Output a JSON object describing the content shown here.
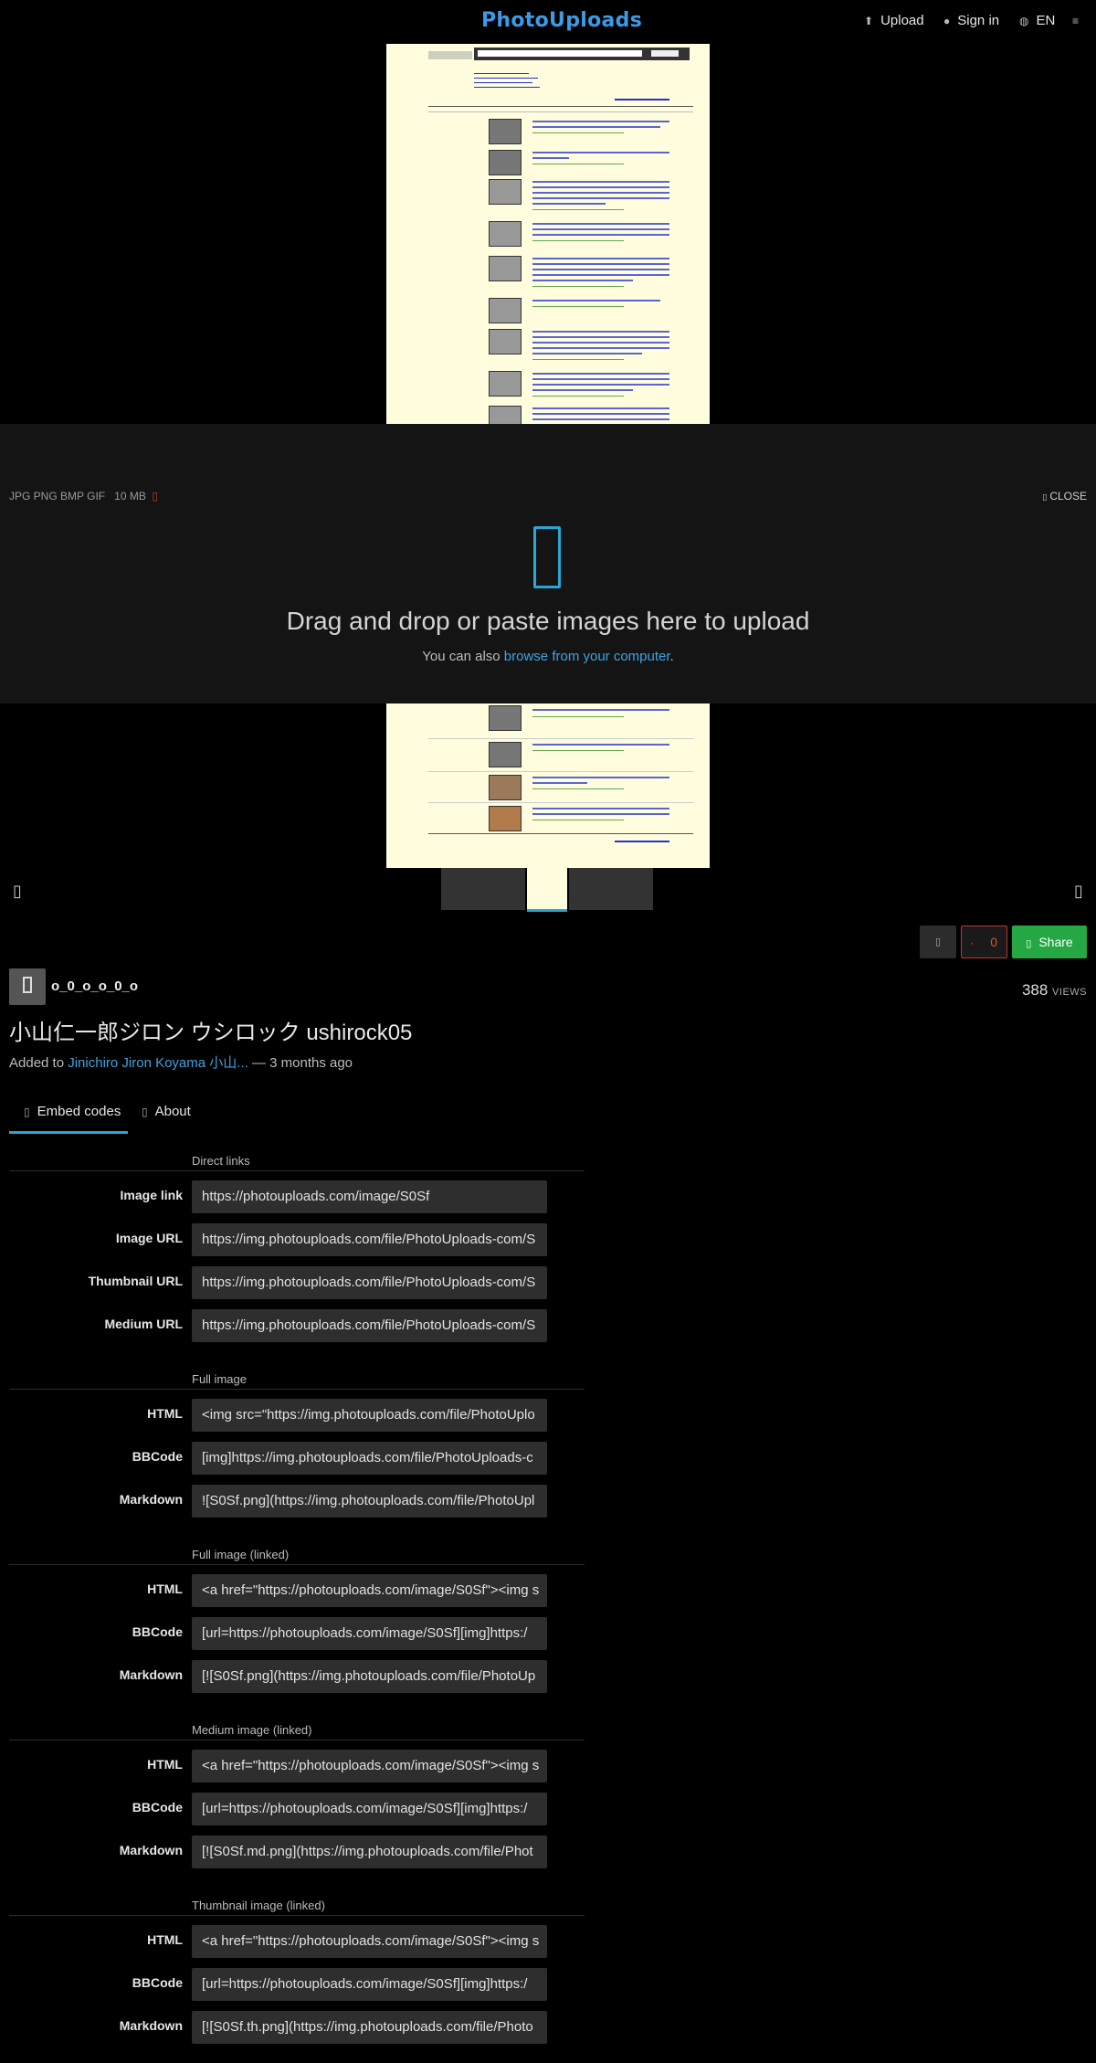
{
  "header": {
    "logo": "PhotoUploads",
    "upload": "Upload",
    "signin": "Sign in",
    "lang": "EN"
  },
  "uploader": {
    "formats": "JPG PNG BMP GIF",
    "max_size": "10 MB",
    "close": "CLOSE",
    "heading": "Drag and drop or paste images here to upload",
    "sub_prefix": "You can also ",
    "sub_link": "browse from your computer",
    "sub_suffix": "."
  },
  "actions": {
    "likes": "0",
    "share": "Share"
  },
  "owner": {
    "username": "o_0_o_o_0_o"
  },
  "image": {
    "views": "388",
    "views_label": "VIEWS",
    "title": "小山仁一郎ジロン ウシロック ushirock05",
    "added_prefix": "Added to ",
    "album": "Jinichiro Jiron Koyama 小山...",
    "added_suffix": " — 3 months ago"
  },
  "tabs": {
    "embed": "Embed codes",
    "about": "About"
  },
  "embed": {
    "direct": {
      "title": "Direct links",
      "image_link_label": "Image link",
      "image_link": "https://photouploads.com/image/S0Sf",
      "image_url_label": "Image URL",
      "image_url": "https://img.photouploads.com/file/PhotoUploads-com/S",
      "thumb_url_label": "Thumbnail URL",
      "thumb_url": "https://img.photouploads.com/file/PhotoUploads-com/S",
      "medium_url_label": "Medium URL",
      "medium_url": "https://img.photouploads.com/file/PhotoUploads-com/S"
    },
    "full": {
      "title": "Full image",
      "html_label": "HTML",
      "html": "<img src=\"https://img.photouploads.com/file/PhotoUplo",
      "bbcode_label": "BBCode",
      "bbcode": "[img]https://img.photouploads.com/file/PhotoUploads-c",
      "md_label": "Markdown",
      "md": "![S0Sf.png](https://img.photouploads.com/file/PhotoUpl"
    },
    "full_linked": {
      "title": "Full image (linked)",
      "html_label": "HTML",
      "html": "<a href=\"https://photouploads.com/image/S0Sf\"><img s",
      "bbcode_label": "BBCode",
      "bbcode": "[url=https://photouploads.com/image/S0Sf][img]https:/",
      "md_label": "Markdown",
      "md": "[![S0Sf.png](https://img.photouploads.com/file/PhotoUp"
    },
    "medium_linked": {
      "title": "Medium image (linked)",
      "html_label": "HTML",
      "html": "<a href=\"https://photouploads.com/image/S0Sf\"><img s",
      "bbcode_label": "BBCode",
      "bbcode": "[url=https://photouploads.com/image/S0Sf][img]https:/",
      "md_label": "Markdown",
      "md": "[![S0Sf.md.png](https://img.photouploads.com/file/Phot"
    },
    "thumb_linked": {
      "title": "Thumbnail image (linked)",
      "html_label": "HTML",
      "html": "<a href=\"https://photouploads.com/image/S0Sf\"><img s",
      "bbcode_label": "BBCode",
      "bbcode": "[url=https://photouploads.com/image/S0Sf][img]https:/",
      "md_label": "Markdown",
      "md": "[![S0Sf.th.png](https://img.photouploads.com/file/Photo"
    }
  },
  "colors": {
    "accent": "#2aa5d6",
    "link": "#3fa3e0",
    "share": "#25a844",
    "like_border": "#c0392b"
  },
  "icons": [
    "upload-icon",
    "user-icon",
    "globe-icon",
    "menu-icon",
    "cloud-upload-icon",
    "chevron-left-icon",
    "chevron-right-icon",
    "flag-icon",
    "heart-icon",
    "share-icon",
    "code-icon",
    "info-icon"
  ]
}
